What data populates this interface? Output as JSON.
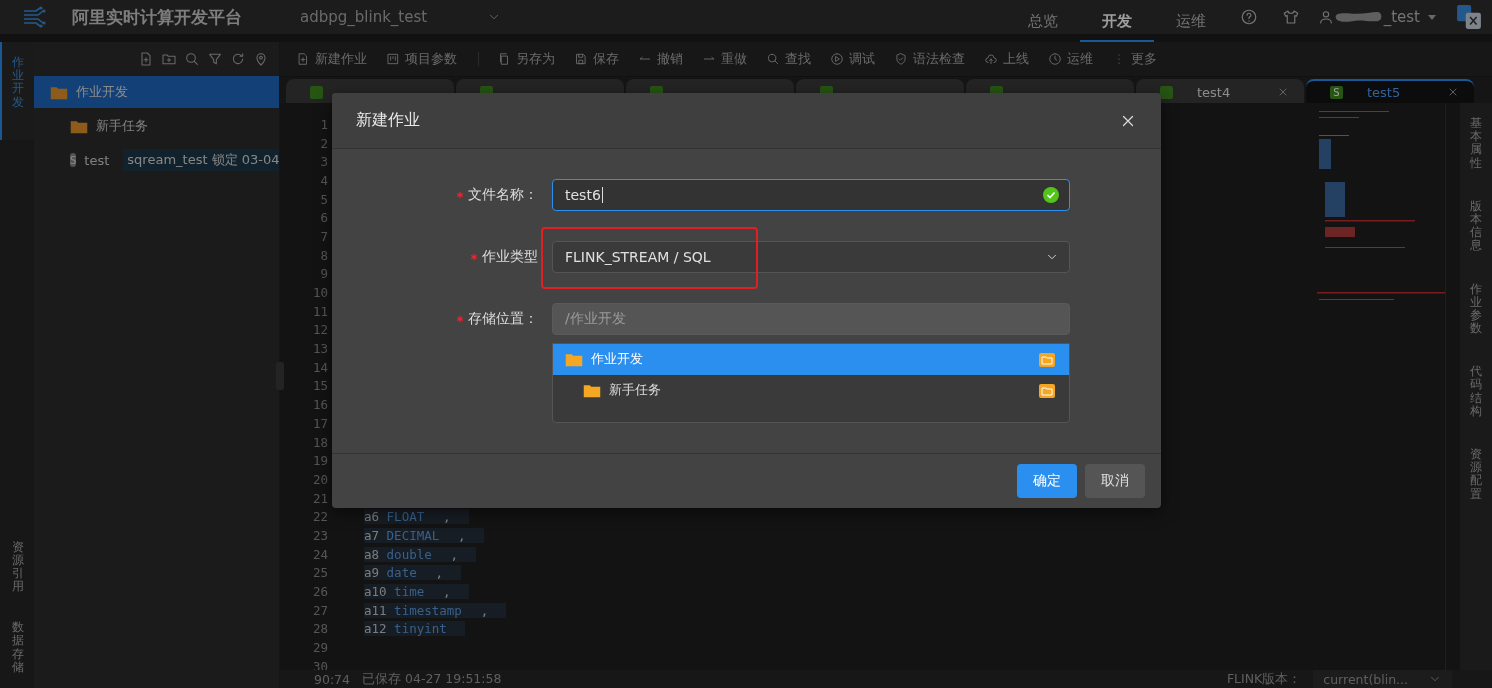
{
  "header": {
    "title": "阿里实时计算开发平台",
    "project": "adbpg_blink_test",
    "nav": [
      {
        "label": "总览",
        "selected": false
      },
      {
        "label": "开发",
        "selected": true
      },
      {
        "label": "运维",
        "selected": false
      }
    ],
    "user": "_test"
  },
  "left_rail": [
    {
      "label": "作业开发",
      "selected": true
    },
    {
      "label": "资源引用",
      "selected": false
    },
    {
      "label": "数据存储",
      "selected": false
    }
  ],
  "sidebar": {
    "tree": [
      {
        "label": "作业开发",
        "kind": "folder",
        "selected": true,
        "children": [
          {
            "label": "新手任务",
            "kind": "folder",
            "selected": false
          },
          {
            "label": "test",
            "kind": "file",
            "badge": "S",
            "lock": "sqream_test 锁定 03-04",
            "selected": false
          }
        ]
      }
    ]
  },
  "toolbar": [
    [
      "新建作业",
      "项目参数"
    ],
    [
      "另存为",
      "保存",
      "撤销",
      "重做",
      "查找",
      "调试",
      "语法检查",
      "上线",
      "运维",
      "更多"
    ]
  ],
  "tabs": [
    {
      "selected": false
    },
    {
      "selected": false
    },
    {
      "selected": false
    },
    {
      "selected": false
    },
    {
      "selected": false
    },
    {
      "label": "test4",
      "selected": false
    },
    {
      "badge": "S",
      "label": "test5",
      "selected": true
    }
  ],
  "editor": {
    "lines": [
      {
        "no": "1"
      },
      {
        "no": "2"
      },
      {
        "no": "3"
      },
      {
        "no": "4"
      },
      {
        "no": "5"
      },
      {
        "no": "6"
      },
      {
        "no": "7"
      },
      {
        "no": "8"
      },
      {
        "no": "9"
      },
      {
        "no": "10"
      },
      {
        "no": "11"
      },
      {
        "no": "12"
      },
      {
        "no": "13"
      },
      {
        "no": "14"
      },
      {
        "no": "15"
      },
      {
        "no": "16"
      },
      {
        "no": "17"
      },
      {
        "no": "18"
      },
      {
        "no": "19"
      },
      {
        "no": "20"
      },
      {
        "no": "21"
      },
      {
        "no": "22",
        "name": "a6",
        "type": "FLOAT",
        "comma": ","
      },
      {
        "no": "23",
        "name": "a7",
        "type": "DECIMAL",
        "comma": ","
      },
      {
        "no": "24",
        "name": "a8",
        "type": "double",
        "comma": ","
      },
      {
        "no": "25",
        "name": "a9",
        "type": "date",
        "comma": ","
      },
      {
        "no": "26",
        "name": "a10",
        "type": "time",
        "comma": ","
      },
      {
        "no": "27",
        "name": "a11",
        "type": "timestamp",
        "comma": ","
      },
      {
        "no": "28",
        "name": "a12",
        "type": "tinyint"
      },
      {
        "no": "29"
      },
      {
        "no": "30"
      }
    ]
  },
  "right_rail": [
    "基本属性",
    "版本信息",
    "作业参数",
    "代码结构",
    "资源配置"
  ],
  "status_bar": {
    "position": "90:74",
    "saved": "已保存 04-27 19:51:58",
    "version_label": "FLINK版本：",
    "version": "current(blin..."
  },
  "dialog": {
    "title": "新建作业",
    "fields": [
      {
        "kind": "input",
        "label": "文件名称：",
        "required": true,
        "value": "test6",
        "valid": true
      },
      {
        "kind": "select",
        "label": "作业类型",
        "required": true,
        "value": "FLINK_STREAM / SQL",
        "highlighted": true
      },
      {
        "kind": "tree-select",
        "label": "存储位置：",
        "required": true,
        "placeholder": "/作业开发",
        "options": [
          {
            "label": "作业开发",
            "selected": true,
            "children": [
              {
                "label": "新手任务",
                "selected": false
              }
            ]
          }
        ]
      }
    ],
    "buttons": [
      {
        "label": "确定",
        "kind": "primary"
      },
      {
        "label": "取消",
        "kind": "default"
      }
    ]
  }
}
